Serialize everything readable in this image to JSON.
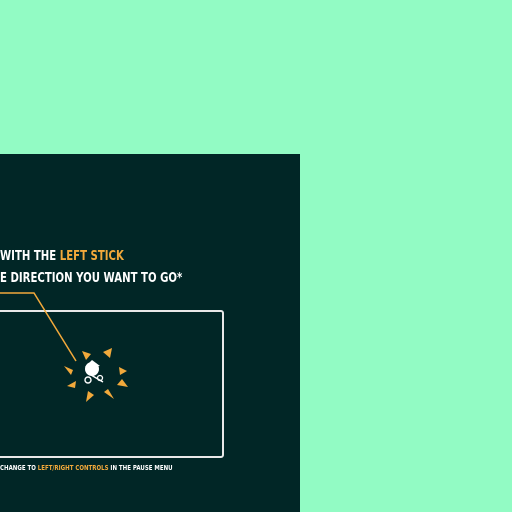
{
  "instructions": {
    "line1_prefix": "WITH THE ",
    "line1_highlight": "LEFT STICK",
    "line2": "E DIRECTION YOU WANT TO GO*"
  },
  "footnote": {
    "prefix": "CHANGE TO ",
    "highlight": "LEFT/RIGHT CONTROLS",
    "suffix": " IN THE PAUSE MENU"
  },
  "colors": {
    "background": "#92fbc4",
    "panel": "#012626",
    "accent": "#f2a93b",
    "frame": "#e8e8e8",
    "text": "#ffffff"
  },
  "icons": {
    "character": "player-character-icon",
    "arrows": "direction-arrows-icon",
    "pointer": "callout-line"
  }
}
